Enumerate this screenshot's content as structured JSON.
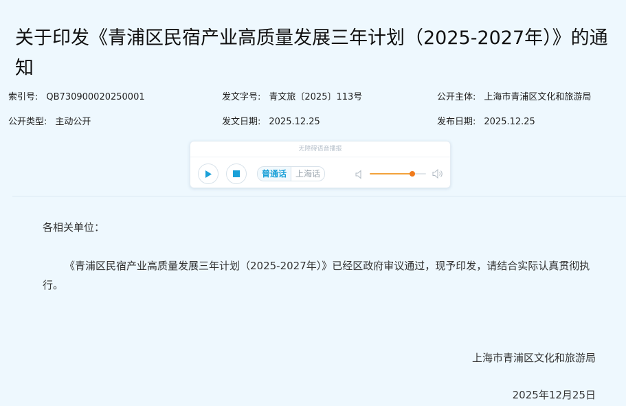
{
  "document": {
    "title": "关于印发《青浦区民宿产业高质量发展三年计划（2025-2027年）》的通知"
  },
  "meta": {
    "index_label": "索引号:",
    "index_value": "QB730900020250001",
    "doc_no_label": "发文字号:",
    "doc_no_value": "青文旅〔2025〕113号",
    "publisher_label": "公开主体:",
    "publisher_value": "上海市青浦区文化和旅游局",
    "open_type_label": "公开类型:",
    "open_type_value": "主动公开",
    "issue_date_label": "发文日期:",
    "issue_date_value": "2025.12.25",
    "publish_date_label": "发布日期:",
    "publish_date_value": "2025.12.25"
  },
  "player": {
    "header": "无障碍语音播报",
    "lang_mandarin": "普通话",
    "lang_shanghainese": "上海话",
    "volume_level": 0.75,
    "accent_color": "#1aa0d8",
    "volume_color": "#f07b1c",
    "play_icon": "play-icon",
    "stop_icon": "stop-icon",
    "volume_low_icon": "volume-low-icon",
    "volume_high_icon": "volume-high-icon"
  },
  "content": {
    "salutation": "各相关单位：",
    "body": "《青浦区民宿产业高质量发展三年计划（2025-2027年）》已经区政府审议通过，现予印发，请结合实际认真贯彻执行。",
    "signer": "上海市青浦区文化和旅游局",
    "sign_date": "2025年12月25日"
  }
}
